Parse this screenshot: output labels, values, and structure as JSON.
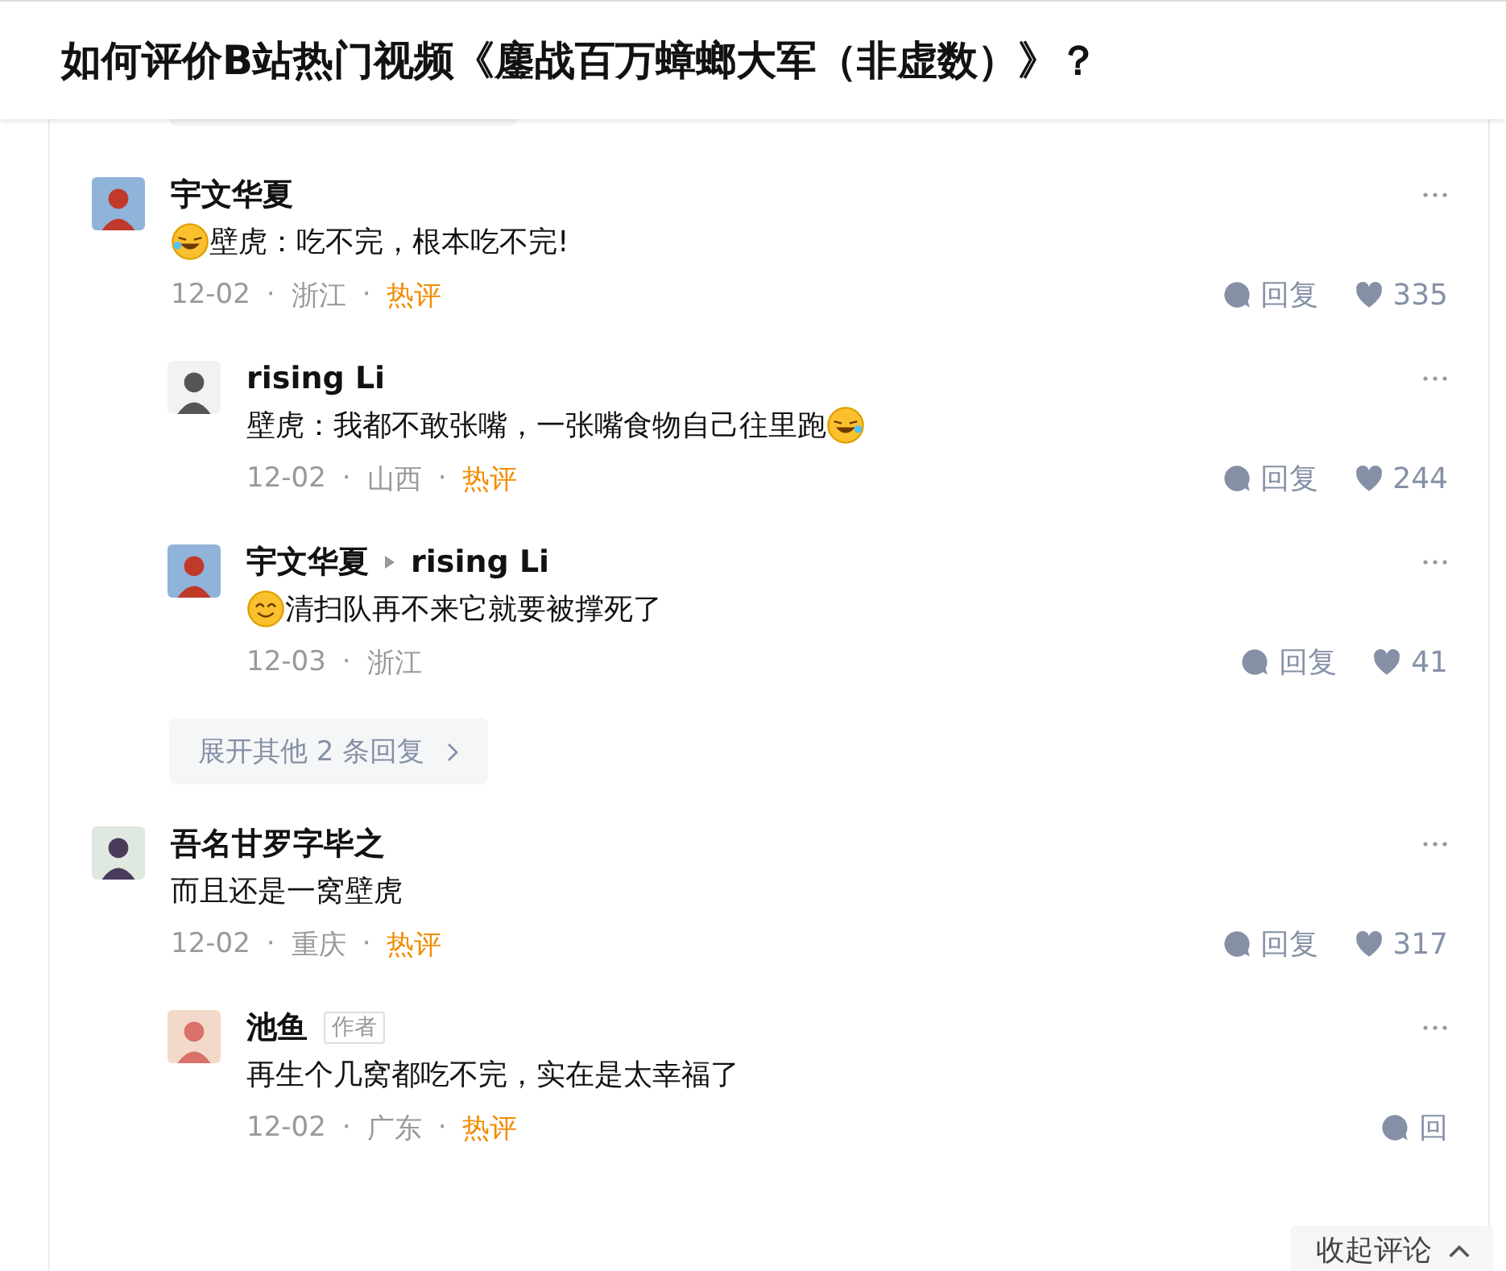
{
  "title": "如何评价B站热门视频《鏖战百万蟑螂大军（非虚数）》？",
  "separator": "·",
  "comments": [
    {
      "name": "宇文华夏",
      "text": [
        {
          "kind": "laughing"
        },
        {
          "kind": "text",
          "text": "壁虎：吃不完，根本吃不完!"
        }
      ],
      "date": "12-02",
      "location": "浙江",
      "hot": "热评",
      "reply": "回复",
      "likes": "335",
      "children": [
        {
          "name": "rising Li",
          "text": [
            {
              "kind": "text",
              "text": "壁虎：我都不敢张嘴，一张嘴食物自己往里跑"
            },
            {
              "kind": "laughing"
            }
          ],
          "date": "12-02",
          "location": "山西",
          "hot": "热评",
          "reply": "回复",
          "likes": "244"
        },
        {
          "name": "宇文华夏",
          "reply_to": "rising Li",
          "text": [
            {
              "kind": "smiling"
            },
            {
              "kind": "text",
              "text": "清扫队再不来它就要被撑死了"
            }
          ],
          "date": "12-03",
          "location": "浙江",
          "reply": "回复",
          "likes": "41"
        }
      ],
      "more": "展开其他 2 条回复"
    },
    {
      "name": "吾名甘罗字毕之",
      "text": [
        {
          "kind": "text",
          "text": "而且还是一窝壁虎"
        }
      ],
      "date": "12-02",
      "location": "重庆",
      "hot": "热评",
      "reply": "回复",
      "likes": "317",
      "children": [
        {
          "name": "池鱼",
          "badge": "作者",
          "text": [
            {
              "kind": "text",
              "text": "再生个几窝都吃不完，实在是太幸福了"
            }
          ],
          "date": "12-02",
          "location": "广东",
          "hot": "热评",
          "reply": "回"
        }
      ]
    }
  ],
  "collapse": "收起评论"
}
